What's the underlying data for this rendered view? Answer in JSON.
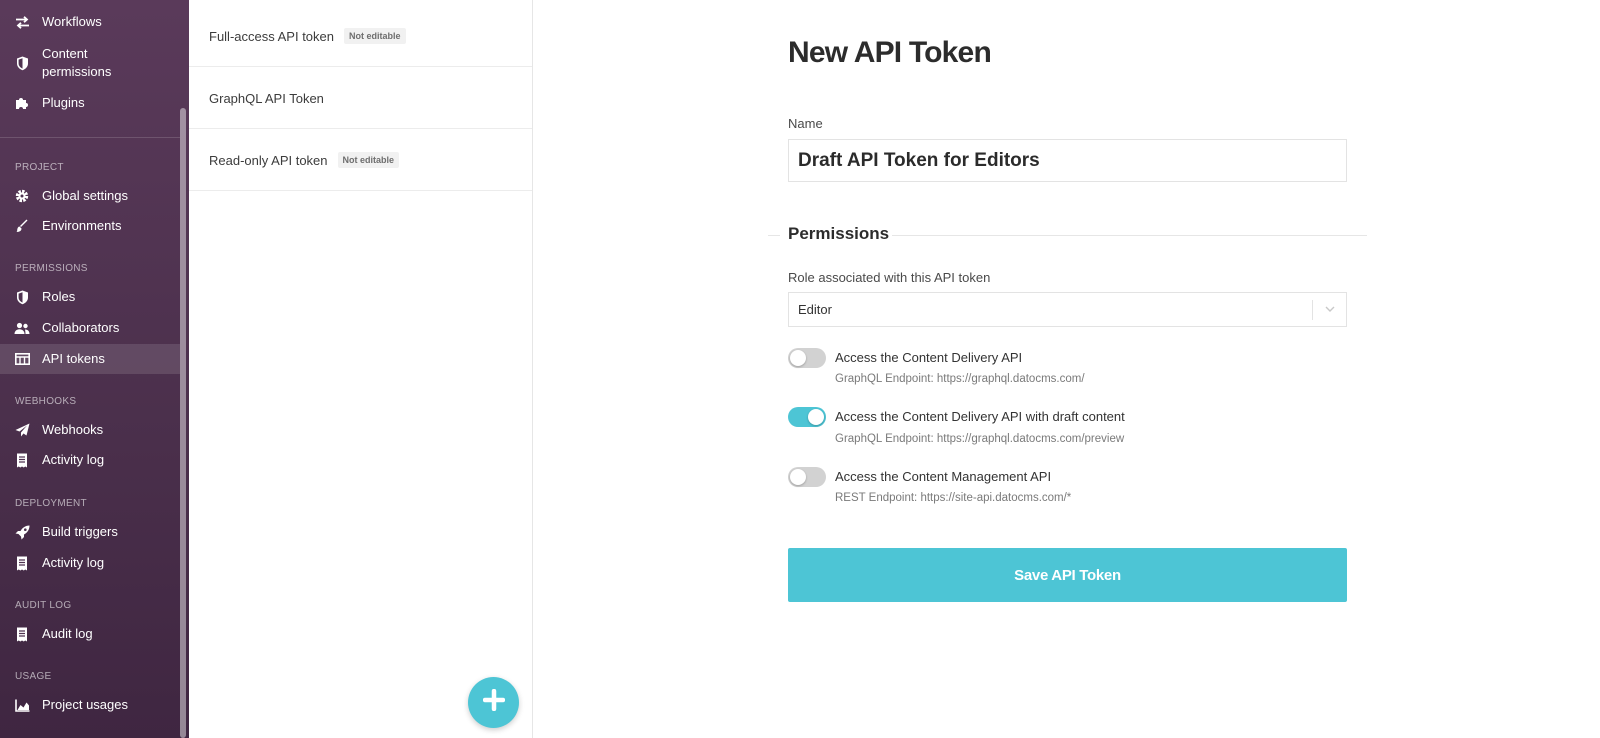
{
  "sidebar": {
    "top_items": [
      {
        "label": "Workflows",
        "icon": "swap-arrows-icon"
      },
      {
        "label": "Content\npermissions",
        "icon": "shield-icon"
      },
      {
        "label": "Plugins",
        "icon": "puzzle-icon"
      }
    ],
    "sections": [
      {
        "heading": "PROJECT",
        "items": [
          {
            "label": "Global settings",
            "icon": "gear-icon"
          },
          {
            "label": "Environments",
            "icon": "brush-icon"
          }
        ]
      },
      {
        "heading": "PERMISSIONS",
        "items": [
          {
            "label": "Roles",
            "icon": "shield-icon"
          },
          {
            "label": "Collaborators",
            "icon": "users-icon"
          },
          {
            "label": "API tokens",
            "icon": "table-icon",
            "active": true
          }
        ]
      },
      {
        "heading": "WEBHOOKS",
        "items": [
          {
            "label": "Webhooks",
            "icon": "paper-plane-icon"
          },
          {
            "label": "Activity log",
            "icon": "receipt-icon"
          }
        ]
      },
      {
        "heading": "DEPLOYMENT",
        "items": [
          {
            "label": "Build triggers",
            "icon": "rocket-icon"
          },
          {
            "label": "Activity log",
            "icon": "receipt-icon"
          }
        ]
      },
      {
        "heading": "AUDIT LOG",
        "items": [
          {
            "label": "Audit log",
            "icon": "receipt-icon"
          }
        ]
      },
      {
        "heading": "USAGE",
        "items": [
          {
            "label": "Project usages",
            "icon": "area-chart-icon"
          }
        ]
      }
    ]
  },
  "tokens": [
    {
      "name": "Full-access API token",
      "badge": "Not editable"
    },
    {
      "name": "GraphQL API Token",
      "badge": ""
    },
    {
      "name": "Read-only API token",
      "badge": "Not editable"
    }
  ],
  "form": {
    "title": "New API Token",
    "name_label": "Name",
    "name_value": "Draft API Token for Editors",
    "permissions_heading": "Permissions",
    "role_label": "Role associated with this API token",
    "role_value": "Editor",
    "toggles": [
      {
        "label": "Access the Content Delivery API",
        "sub": "GraphQL Endpoint: https://graphql.datocms.com/",
        "on": false
      },
      {
        "label": "Access the Content Delivery API with draft content",
        "sub": "GraphQL Endpoint: https://graphql.datocms.com/preview",
        "on": true
      },
      {
        "label": "Access the Content Management API",
        "sub": "REST Endpoint: https://site-api.datocms.com/*",
        "on": false
      }
    ],
    "save_label": "Save API Token"
  },
  "colors": {
    "accent": "#4dc5d5",
    "sidebar": "#4f3350"
  }
}
